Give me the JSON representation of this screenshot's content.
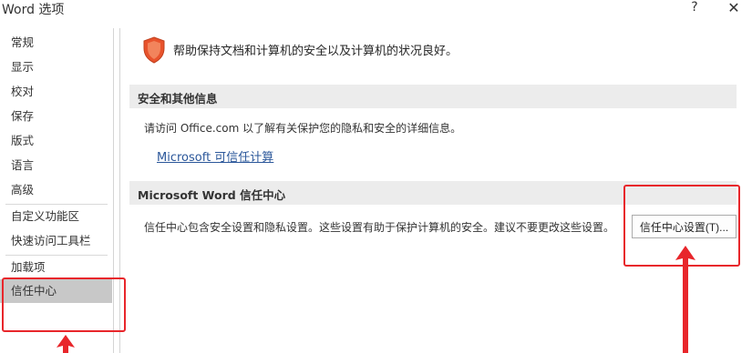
{
  "window": {
    "title": "Word 选项",
    "help_label": "?",
    "close_label": "✕"
  },
  "sidebar": {
    "items": [
      {
        "label": "常规"
      },
      {
        "label": "显示"
      },
      {
        "label": "校对"
      },
      {
        "label": "保存"
      },
      {
        "label": "版式"
      },
      {
        "label": "语言"
      },
      {
        "label": "高级"
      },
      {
        "label": "自定义功能区"
      },
      {
        "label": "快速访问工具栏"
      },
      {
        "label": "加载项"
      },
      {
        "label": "信任中心",
        "selected": true
      }
    ]
  },
  "main": {
    "intro_icon": "shield-icon",
    "intro_text": "帮助保持文档和计算机的安全以及计算机的状况良好。",
    "privacy_section": {
      "title": "安全和其他信息",
      "description": "请访问 Office.com 以了解有关保护您的隐私和安全的详细信息。",
      "link_label": "Microsoft 可信任计算"
    },
    "trust_section": {
      "title": "Microsoft Word 信任中心",
      "description": "信任中心包含安全设置和隐私设置。这些设置有助于保护计算机的安全。建议不要更改这些设置。",
      "button_label": "信任中心设置(T)..."
    }
  },
  "colors": {
    "annotation": "#e8262b",
    "shield": "#e8532c",
    "selected_item": "#c8c8c8",
    "link": "#2b579a"
  }
}
